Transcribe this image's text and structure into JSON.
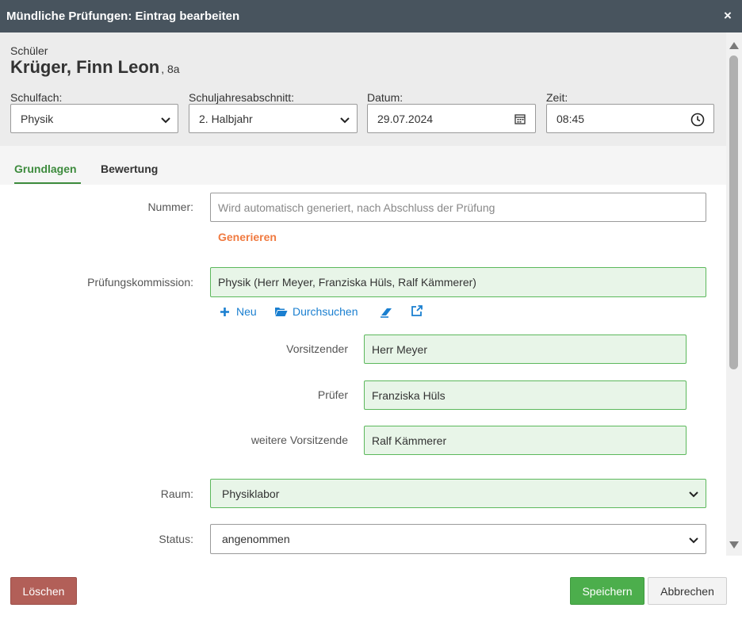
{
  "dialog": {
    "title": "Mündliche Prüfungen: Eintrag bearbeiten",
    "close_icon": "×"
  },
  "student": {
    "label": "Schüler",
    "name": "Krüger, Finn Leon",
    "class": ", 8a"
  },
  "header_fields": {
    "subject": {
      "label": "Schulfach:",
      "value": "Physik"
    },
    "period": {
      "label": "Schuljahresabschnitt:",
      "value": "2. Halbjahr"
    },
    "date": {
      "label": "Datum:",
      "value": "29.07.2024"
    },
    "time": {
      "label": "Zeit:",
      "value": "08:45"
    }
  },
  "tabs": [
    {
      "label": "Grundlagen",
      "active": true
    },
    {
      "label": "Bewertung",
      "active": false
    }
  ],
  "form": {
    "number": {
      "label": "Nummer:",
      "placeholder": "Wird automatisch generiert, nach Abschluss der Prüfung",
      "generate_label": "Generieren"
    },
    "commission": {
      "label": "Prüfungskommission:",
      "value": "Physik (Herr Meyer, Franziska Hüls, Ralf Kämmerer)",
      "actions": {
        "new_label": "Neu",
        "search_label": "Durchsuchen"
      }
    },
    "chair": {
      "label": "Vorsitzender",
      "value": "Herr Meyer"
    },
    "examiner": {
      "label": "Prüfer",
      "value": "Franziska Hüls"
    },
    "further_chair": {
      "label": "weitere Vorsitzende",
      "value": "Ralf Kämmerer"
    },
    "room": {
      "label": "Raum:",
      "value": "Physiklabor"
    },
    "status": {
      "label": "Status:",
      "value": "angenommen"
    }
  },
  "buttons": {
    "delete": "Löschen",
    "save": "Speichern",
    "cancel": "Abbrechen"
  },
  "colors": {
    "titlebar": "#48545e",
    "accent_green": "#3d8b3d",
    "link_blue": "#1a7fd0",
    "link_orange": "#f07a40",
    "delete_red": "#b25f58",
    "save_green": "#4cae4c"
  }
}
